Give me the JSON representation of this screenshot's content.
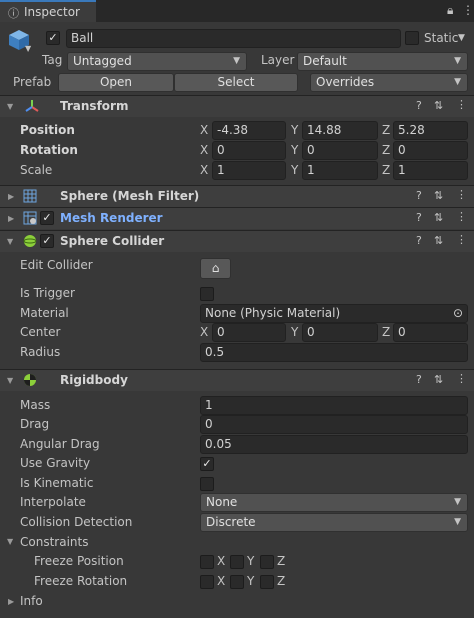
{
  "tab": {
    "label": "Inspector",
    "icon": "info-icon"
  },
  "object": {
    "name": "Ball",
    "static_label": "Static"
  },
  "tag": {
    "label": "Tag",
    "value": "Untagged"
  },
  "layer": {
    "label": "Layer",
    "value": "Default"
  },
  "prefab": {
    "label": "Prefab",
    "open": "Open",
    "select": "Select",
    "overrides": "Overrides"
  },
  "transform": {
    "title": "Transform",
    "position": {
      "label": "Position",
      "x": "-4.38",
      "y": "14.88",
      "z": "5.28"
    },
    "rotation": {
      "label": "Rotation",
      "x": "0",
      "y": "0",
      "z": "0"
    },
    "scale": {
      "label": "Scale",
      "x": "1",
      "y": "1",
      "z": "1"
    }
  },
  "mesh_filter": {
    "title": "Sphere (Mesh Filter)"
  },
  "mesh_renderer": {
    "title": "Mesh Renderer"
  },
  "sphere_collider": {
    "title": "Sphere Collider",
    "edit_collider": "Edit Collider",
    "is_trigger": "Is Trigger",
    "material_label": "Material",
    "material_value": "None (Physic Material)",
    "center_label": "Center",
    "center": {
      "x": "0",
      "y": "0",
      "z": "0"
    },
    "radius_label": "Radius",
    "radius_value": "0.5"
  },
  "rigidbody": {
    "title": "Rigidbody",
    "mass_label": "Mass",
    "mass": "1",
    "drag_label": "Drag",
    "drag": "0",
    "angular_drag_label": "Angular Drag",
    "angular_drag": "0.05",
    "use_gravity_label": "Use Gravity",
    "is_kinematic_label": "Is Kinematic",
    "interpolate_label": "Interpolate",
    "interpolate": "None",
    "collision_label": "Collision Detection",
    "collision": "Discrete",
    "constraints_label": "Constraints",
    "freeze_position_label": "Freeze Position",
    "freeze_rotation_label": "Freeze Rotation"
  },
  "axes": {
    "x": "X",
    "y": "Y",
    "z": "Z"
  },
  "info_label": "Info",
  "colors": {
    "accent": "#3a79bb",
    "link": "#7fb1ff",
    "background": "#383838"
  }
}
